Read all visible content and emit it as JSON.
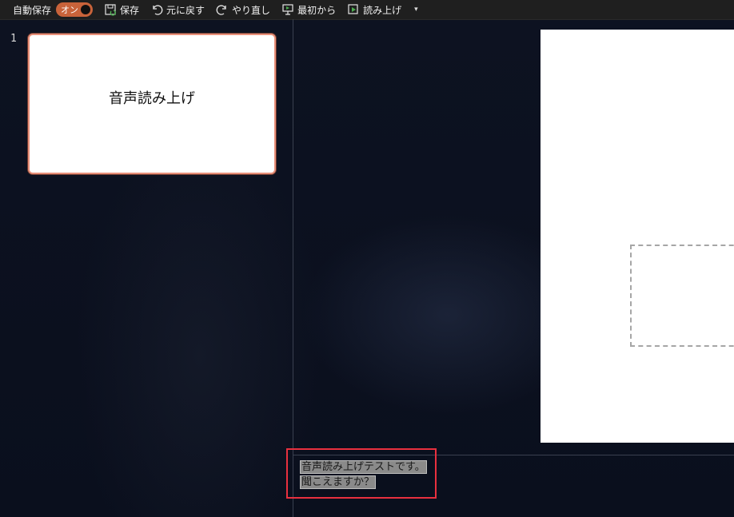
{
  "toolbar": {
    "autosave_label": "自動保存",
    "autosave_toggle": "オン",
    "buttons": [
      {
        "label": "保存",
        "icon": "save-icon"
      },
      {
        "label": "元に戻す",
        "icon": "undo-icon"
      },
      {
        "label": "やり直し",
        "icon": "redo-icon"
      },
      {
        "label": "最初から",
        "icon": "slideshow-start-icon"
      },
      {
        "label": "読み上げ",
        "icon": "read-aloud-icon"
      }
    ],
    "more_icon": "▾"
  },
  "thumbnails": [
    {
      "number": "1",
      "title": "音声読み上げ"
    }
  ],
  "notes": {
    "lines": [
      "音声読み上げテストです。",
      "聞こえますか？"
    ]
  },
  "colors": {
    "toggle": "#c9633a",
    "thumb_border": "#e9907a",
    "highlight_box": "#e8303f"
  }
}
